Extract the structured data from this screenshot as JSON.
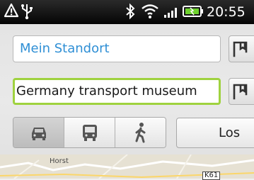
{
  "status_bar": {
    "time": "20:55",
    "icons": [
      "warning-icon",
      "usb-icon",
      "bluetooth-icon",
      "wifi-icon",
      "signal-icon",
      "battery-icon"
    ]
  },
  "route": {
    "from_value": "Mein Standort",
    "to_value": "Germany transport museum",
    "go_label": "Los",
    "modes": [
      "car",
      "transit",
      "walking"
    ],
    "selected_mode": "car"
  },
  "map": {
    "town_label": "Horst",
    "road_label": "K61"
  },
  "colors": {
    "accent_text": "#2f8fd5",
    "focus_border": "#9fd23f"
  }
}
